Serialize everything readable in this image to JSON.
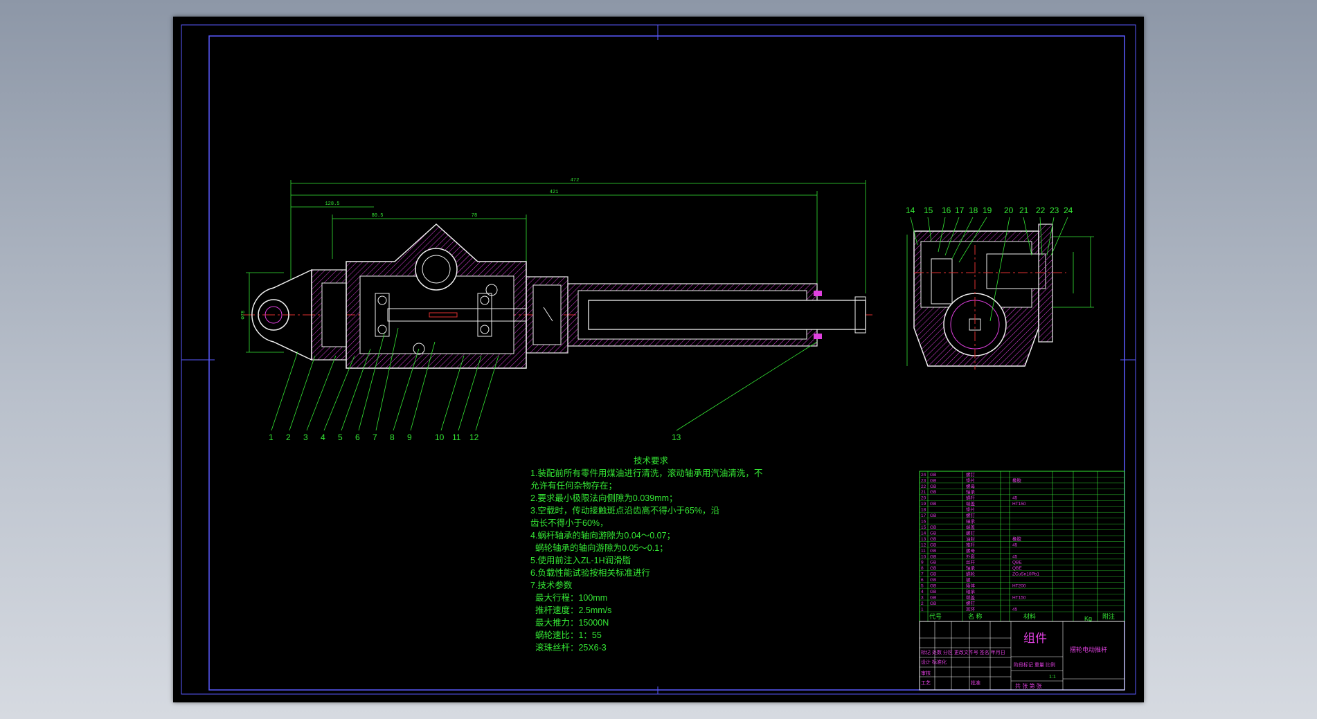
{
  "balloons": [
    "1",
    "2",
    "3",
    "4",
    "5",
    "6",
    "7",
    "8",
    "9",
    "10",
    "11",
    "12",
    "13",
    "14",
    "15",
    "16",
    "17",
    "18",
    "19",
    "20",
    "21",
    "22",
    "23",
    "24"
  ],
  "dimensions": {
    "overall_1": "472",
    "overall_2": "421",
    "dim_a": "128.5",
    "dim_b": "80.5",
    "dim_c": "78",
    "left_height": "Φ78"
  },
  "tech_req": {
    "title": "技术要求",
    "lines": [
      "1.装配前所有零件用煤油进行清洗，滚动轴承用汽油清洗，不",
      "允许有任何杂物存在；",
      "2.要求最小极限法向侧隙为0.039mm；",
      "3.空载时，传动接触斑点沿齿高不得小于65%，沿",
      "齿长不得小于60%，",
      "4.蜗杆轴承的轴向游隙为0.04～0.07；",
      "  蜗轮轴承的轴向游隙为0.05～0.1；",
      "5.使用前注入ZL-1H润滑脂",
      "6.负载性能试验按相关标准进行",
      "7.技术参数",
      "  最大行程：100mm",
      "  推杆速度：2.5mm/s",
      "  最大推力：15000N",
      "  蜗轮速比：1：55",
      "  滚珠丝杆：25X6-3"
    ]
  },
  "title_block": {
    "part_title": "组件",
    "drawing_name": "摆轮电动推杆",
    "col_code": "代号",
    "col_name": "名 称",
    "col_material": "材料",
    "col_note": "附注",
    "col_weight": "Kg",
    "row_labels_1": "标记 处数 分区 更改文件号 签名 年月日",
    "row_labels_2": "设计 标准化",
    "stage_labels": "阶段标记 重量 比例",
    "sheet_info": "共 张 第 张",
    "check": "审核",
    "craft": "工艺",
    "approve": "批准",
    "scale": "1:1"
  },
  "bom_rows": [
    {
      "no": "24",
      "code": "GB",
      "name": "螺钉",
      "mat": ""
    },
    {
      "no": "23",
      "code": "GB",
      "name": "垫片",
      "mat": "橡胶"
    },
    {
      "no": "22",
      "code": "GB",
      "name": "螺母",
      "mat": ""
    },
    {
      "no": "21",
      "code": "GB",
      "name": "轴承",
      "mat": ""
    },
    {
      "no": "20",
      "code": "",
      "name": "蜗杆",
      "mat": "45"
    },
    {
      "no": "19",
      "code": "GB",
      "name": "端盖",
      "mat": "HT150"
    },
    {
      "no": "18",
      "code": "",
      "name": "垫片",
      "mat": ""
    },
    {
      "no": "17",
      "code": "GB",
      "name": "螺钉",
      "mat": ""
    },
    {
      "no": "16",
      "code": "",
      "name": "轴承",
      "mat": ""
    },
    {
      "no": "15",
      "code": "GB",
      "name": "端盖",
      "mat": ""
    },
    {
      "no": "14",
      "code": "GB",
      "name": "螺钉",
      "mat": ""
    },
    {
      "no": "13",
      "code": "GB",
      "name": "油封",
      "mat": "橡胶"
    },
    {
      "no": "12",
      "code": "GB",
      "name": "推杆",
      "mat": "45"
    },
    {
      "no": "11",
      "code": "GB",
      "name": "螺母",
      "mat": ""
    },
    {
      "no": "10",
      "code": "GB",
      "name": "外套",
      "mat": "45"
    },
    {
      "no": "9",
      "code": "GB",
      "name": "丝杆",
      "mat": "QBE"
    },
    {
      "no": "8",
      "code": "GB",
      "name": "轴承",
      "mat": "QBE"
    },
    {
      "no": "7",
      "code": "GB",
      "name": "蜗轮",
      "mat": "ZCuSn10Pb1"
    },
    {
      "no": "6",
      "code": "GB",
      "name": "键",
      "mat": ""
    },
    {
      "no": "5",
      "code": "GB",
      "name": "箱体",
      "mat": "HT200"
    },
    {
      "no": "4",
      "code": "GB",
      "name": "轴承",
      "mat": ""
    },
    {
      "no": "3",
      "code": "GB",
      "name": "端盖",
      "mat": "HT150"
    },
    {
      "no": "2",
      "code": "GB",
      "name": "螺钉",
      "mat": ""
    },
    {
      "no": "1",
      "code": "",
      "name": "耳环",
      "mat": "45"
    }
  ]
}
